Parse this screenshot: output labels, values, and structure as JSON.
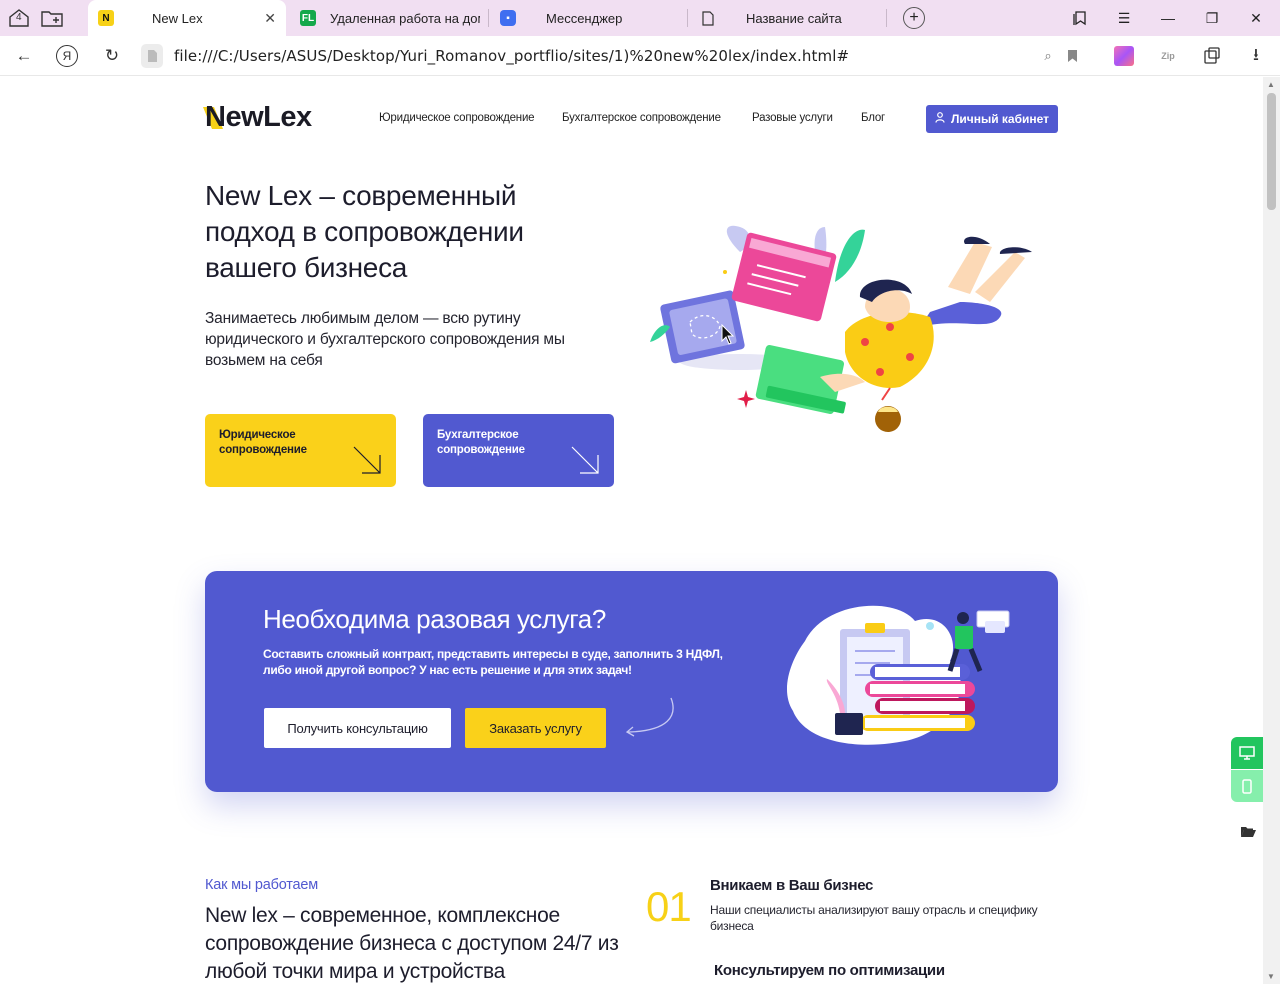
{
  "browser": {
    "tab_count": "4",
    "tabs": [
      {
        "title": "New Lex",
        "favicon": "N",
        "active": true
      },
      {
        "title": "Удаленная работа на дому",
        "favicon": "FL",
        "active": false
      },
      {
        "title": "Мессенджер",
        "favicon": "chat",
        "active": false
      },
      {
        "title": "Название сайта",
        "favicon": "doc",
        "active": false
      }
    ],
    "url": "file:///C:/Users/ASUS/Desktop/Yuri_Romanov_portflio/sites/1)%20new%20lex/index.html#",
    "protect_letter": "Я",
    "ext_zip": "Zip"
  },
  "site": {
    "logo": "NewLex",
    "nav": [
      "Юридическое сопровождение",
      "Бухгалтерское сопровождение",
      "Разовые услуги",
      "Блог"
    ],
    "cabinet_label": "Личный кабинет",
    "hero": {
      "title": "New Lex – современный подход в сопровождении вашего бизнеса",
      "subtitle": "Занимаетесь любимым делом — всю рутину юридического и бухгалтерского сопровождения мы возьмем на себя",
      "btn_legal": "Юридическое сопровождение",
      "btn_accounting": "Бухгалтерское сопровождение"
    },
    "promo": {
      "title": "Необходима разовая услуга?",
      "text": "Составить сложный контракт, представить интересы в суде, заполнить 3 НДФЛ, либо иной другой вопрос? У нас есть решение и для этих задач!",
      "btn_consult": "Получить консультацию",
      "btn_order": "Заказать услугу"
    },
    "how": {
      "label": "Как мы работаем",
      "title": "New lex – современное, комплексное сопровождение бизнеса с доступом 24/7 из любой точки мира и устройства",
      "steps": [
        {
          "num": "01",
          "title": "Вникаем в Ваш бизнес",
          "text": "Наши специалисты анализируют вашу отрасль и специфику бизнеса"
        },
        {
          "title": "Консультируем по оптимизации"
        }
      ]
    }
  },
  "colors": {
    "accent_blue": "#5159d0",
    "accent_yellow": "#fad11a",
    "tabbar": "#f1dff2"
  }
}
